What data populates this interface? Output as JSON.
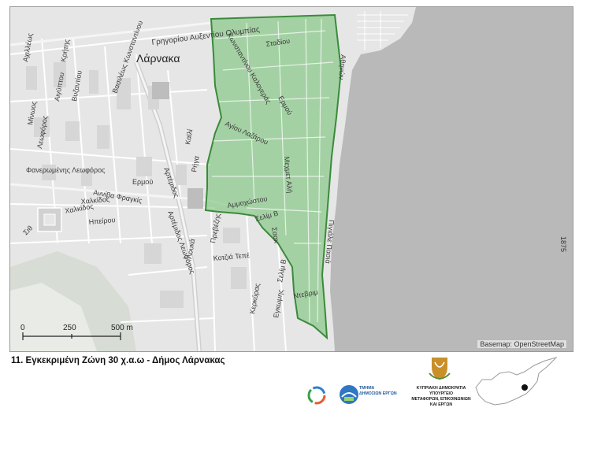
{
  "map": {
    "city_label": "Λάρνακα",
    "basemap_credit": "Basemap: OpenStreetMap",
    "zone_color": "#8bc98b",
    "zone_border_color": "#3b8a3b",
    "sea_color": "#b9b9b9",
    "land_color": "#e6e6e6",
    "streets": [
      "Γρηγορίου Αυξεντίου Ολυμπίας",
      "Σταδίου",
      "Κωνσταντίνου Καλογεράς",
      "Ερμού",
      "Αγίου Λαζάρου",
      "Μεχμετ Αλή",
      "Σελίμ Β",
      "Σαακ",
      "Ντεβριμ",
      "Αθηνών",
      "Πιγιάλε Πασιά",
      "Αχιλλέως",
      "Κρήτης",
      "Αιγύπτου",
      "Μίνωος",
      "Βυζαντίου",
      "Χαλκίδος",
      "Ηπείρου",
      "Λεωφόρος",
      "Βασιλέως Κωνσταντίνου",
      "Αρτέμιδος",
      "Ερμού",
      "Φανερωμένης Λεωφόρος",
      "Αννίβα Φραγκίς",
      "Πρεβέζης",
      "Καϊλί",
      "Κοτζιά Τεπέ",
      "Κερκύρας",
      "Αμμοχώστου",
      "Λουκά",
      "Ρήγα",
      "Σιθ",
      "Χαλκίδος",
      "Αρτέμιδος Λεωφόρος",
      "Εγκωμης",
      "Σελίμ Β"
    ],
    "scale_bar": {
      "labels": [
        "0",
        "250",
        "500 m"
      ]
    }
  },
  "side_number": "1875",
  "title": "11. Εγκεκριμένη Ζώνη 30 χ.α.ω - Δήμος Λάρνακας",
  "logos": {
    "department": [
      "ΤΜΗΜΑ",
      "ΔΗΜΟΣΙΩΝ ΕΡΓΩΝ"
    ],
    "ministry": [
      "ΚΥΠΡΙΑΚΗ ΔΗΜΟΚΡΑΤΙΑ",
      "ΥΠΟΥΡΓΕΙΟ",
      "ΜΕΤΑΦΟΡΩΝ, ΕΠΙΚΟΙΝΩΝΙΩΝ",
      "ΚΑΙ ΕΡΓΩΝ"
    ]
  }
}
